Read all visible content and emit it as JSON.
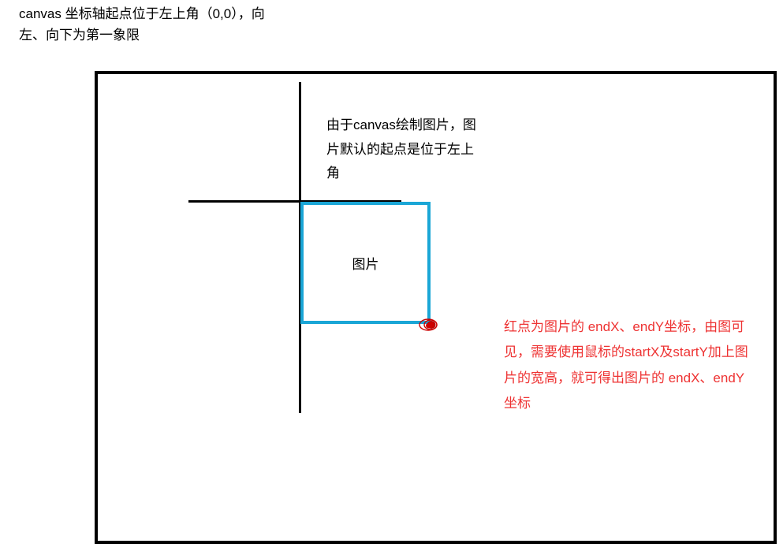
{
  "title_line1": "canvas 坐标轴起点位于左上角（0,0），向",
  "title_line2": "左、向下为第一象限",
  "annotation_top": "由于canvas绘制图片，图片默认的起点是位于左上角",
  "image_label": "图片",
  "annotation_red": "红点为图片的 endX、endY坐标，由图可见，需要使用鼠标的startX及startY加上图片的宽高，就可得出图片的 endX、endY坐标",
  "colors": {
    "axis": "#000000",
    "image_box_border": "#1aa6d6",
    "red_dot": "#d11",
    "red_text": "#e33"
  }
}
